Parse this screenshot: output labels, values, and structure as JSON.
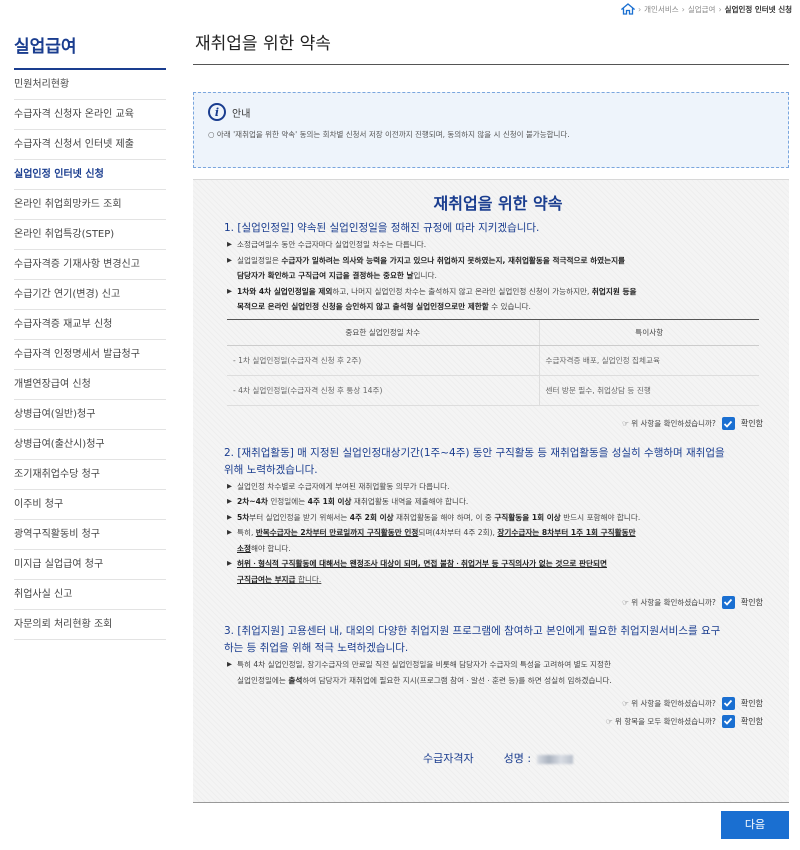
{
  "breadcrumb": {
    "items": [
      "개인서비스",
      "실업급여"
    ],
    "current": "실업인정 인터넷 신청"
  },
  "sidebar": {
    "title": "실업급여",
    "items": [
      "민원처리현황",
      "수급자격 신청자 온라인 교육",
      "수급자격 신청서 인터넷 제출",
      "실업인정 인터넷 신청",
      "온라인 취업희망카드 조회",
      "온라인 취업특강(STEP)",
      "수급자격증 기재사항 변경신고",
      "수급기간 연기(변경) 신고",
      "수급자격증 재교부 신청",
      "수급자격 인정명세서 발급청구",
      "개별연장급여 신청",
      "상병급여(일반)청구",
      "상병급여(출산시)청구",
      "조기재취업수당 청구",
      "이주비 청구",
      "광역구직활동비 청구",
      "미지급 실업급여 청구",
      "취업사실 신고",
      "자문의뢰 처리현황 조회"
    ]
  },
  "page_title": "재취업을 위한 약속",
  "notice": {
    "label": "안내",
    "text": "○ 아래 '재취업을 위한 약속' 동의는 회차별 신청서 저장 이전까지 진행되며, 동의하지 않을 시 신청이 불가능합니다."
  },
  "pledge": {
    "title": "재취업을 위한 약속",
    "s1": {
      "head": "1. [실업인정일] 약속된 실업인정일을 정해진 규정에 따라 지키겠습니다.",
      "b1": "소정급여일수 동안 수급자마다 실업인정일 차수는 다릅니다.",
      "b2a": "실업일정일은 ",
      "b2b": "수급자가 일하려는 의사와 능력을 가지고 있으나 취업하지 못하였는지, 재취업활동을 적극적으로 하였는지를",
      "b2c": "담당자가 확인하고 구직급여 지급을 결정하는 중요한 날",
      "b2d": "입니다.",
      "b3a": "1차와 4차 실업인정일을 제외",
      "b3b": "하고, 나머지 실업인정 차수는 출석하지 않고 온라인 실업인정 신청이 가능하지만, ",
      "b3c": "취업지원 등을",
      "b3d": "목적으로 온라인 실업인정 신청을 승인하지 않고 출석형 실업인정으로만 제한할",
      "b3e": " 수 있습니다.",
      "table": {
        "headers": [
          "중요한 실업인정일 차수",
          "특이사항"
        ],
        "rows": [
          [
            "- 1차 실업인정일(수급자격 신청 후 2주)",
            "수급자격증 배포, 실업인정 집체교육"
          ],
          [
            "- 4차 실업인정일(수급자격 신청 후 통상 14주)",
            "센터 방문 필수, 취업상담 등 진행"
          ]
        ]
      },
      "confirm_q": "☞ 위 사항을 확인하셨습니까?",
      "confirm_label": "확인함"
    },
    "s2": {
      "head1": "2. [재취업활동] 매 지정된 실업인정대상기간(1주~4주) 동안 구직활동 등 재취업활동을 성실히 수행하며 재취업을",
      "head2": "위해 노력하겠습니다.",
      "b1": "실업인정 차수별로 수급자에게 부여된 재취업활동 의무가 다릅니다.",
      "b2a": "2차~4차",
      "b2b": " 인정일에는 ",
      "b2c": "4주 1회 이상",
      "b2d": " 재취업활동 내역을 제출해야 합니다.",
      "b3a": "5차",
      "b3b": "부터 실업인정을 받기 위해서는 ",
      "b3c": "4주 2회 이상",
      "b3d": " 재취업활동을 해야 하며, 이 중 ",
      "b3e": "구직활동을 1회 이상",
      "b3f": " 반드시 포함해야 합니다.",
      "b4a": "특히, ",
      "b4b": "반복수급자는 2차부터 만료일까지 구직활동만 인정",
      "b4c": "되며(4차부터 4주 2회), ",
      "b4d": "장기수급자는 8차부터 1주 1회 구직활동만",
      "b4e": "소정",
      "b4f": "해야 합니다.",
      "b5a": "허위ㆍ형식적 구직활동에 대해서는 왠정조사 대상이 되며, 면접 불참ㆍ취업거부 등 구직의사가 없는 것으로 판단되면",
      "b5b": "구직급여는 부지급",
      "b5c": " 합니다.",
      "confirm_q": "☞ 위 사항을 확인하셨습니까?",
      "confirm_label": "확인함"
    },
    "s3": {
      "head1": "3. [취업지원] 고용센터 내, 대외의 다양한 취업지원 프로그램에 참여하고 본인에게 필요한 취업지원서비스를 요구",
      "head2": "하는 등 취업을 위해 적극 노력하겠습니다.",
      "b1a": "특히 4차 실업인정일, 장기수급자의 만료일 직전 실업인정일을 비롯해 담당자가 수급자의 특성을 고려하여 별도 지정한",
      "b1b": "실업인정일에는 ",
      "b1c": "출석",
      "b1d": "하여 담당자가 재취업에 필요한 지시(프로그램 참여ㆍ알선ㆍ훈련 등)를 하면 성실히 임하겠습니다.",
      "confirm_q": "☞ 위 사항을 확인하셨습니까?",
      "confirm_label": "확인함",
      "confirm_all_q": "☞ 위 항목을 모두 확인하셨습니까?",
      "confirm_all_label": "확인함"
    },
    "signature": {
      "role": "수급자격자",
      "name_label": "성명 :"
    }
  },
  "next_button": "다음",
  "colors": {
    "accent": "#1a3d8f",
    "button": "#1a6fd1"
  }
}
